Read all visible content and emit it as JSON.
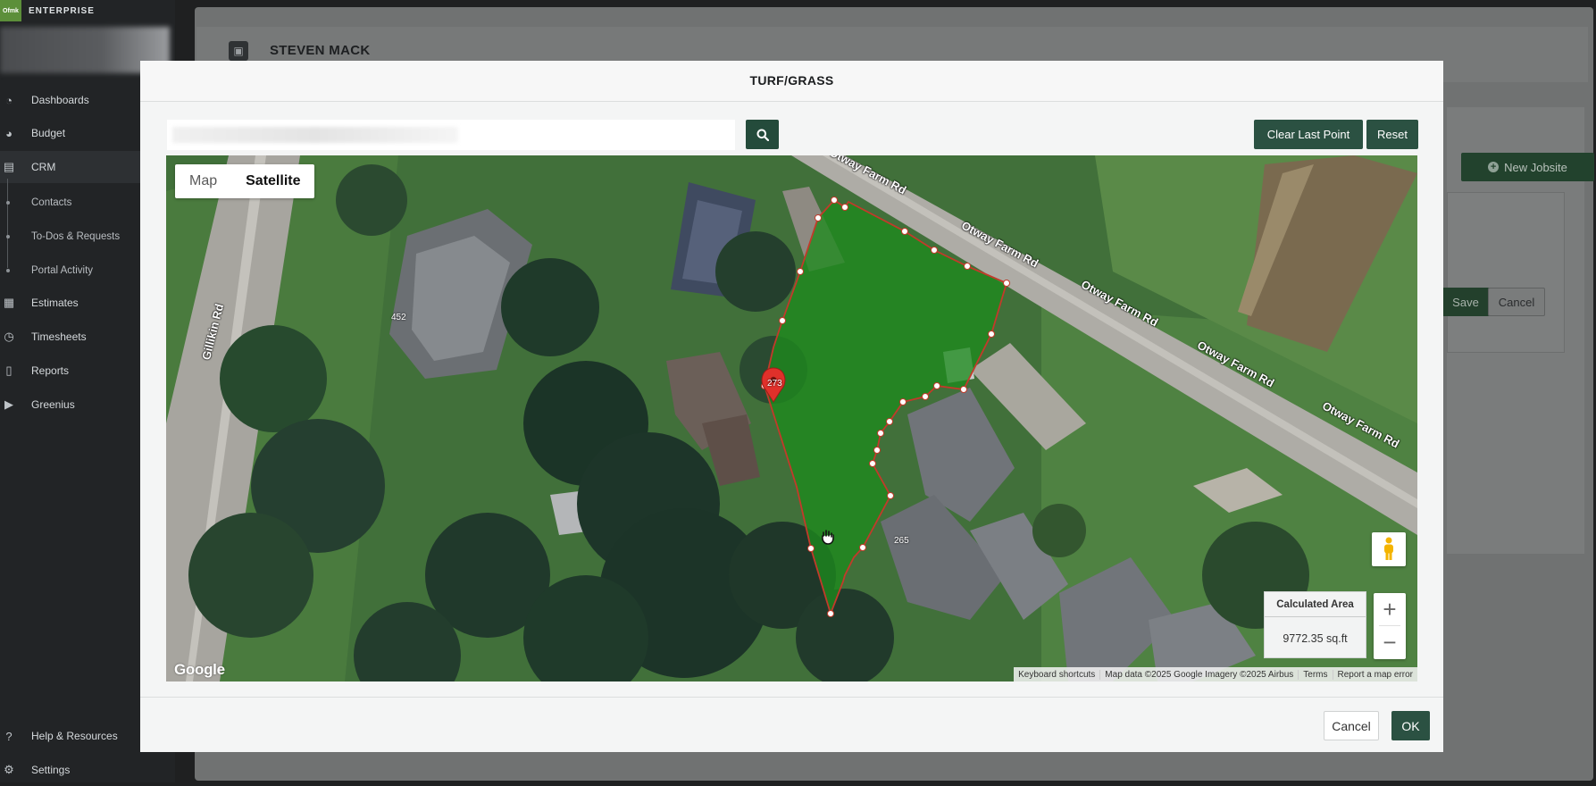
{
  "app": {
    "brand": "ENTERPRISE",
    "logo_text": "Ofmk"
  },
  "sidebar": {
    "items": [
      {
        "label": "Dashboards",
        "icon": "dashboard-icon"
      },
      {
        "label": "Budget",
        "icon": "pie-chart-icon"
      },
      {
        "label": "CRM",
        "icon": "contact-book-icon"
      },
      {
        "label": "Contacts"
      },
      {
        "label": "To-Dos & Requests"
      },
      {
        "label": "Portal Activity"
      },
      {
        "label": "Estimates",
        "icon": "calculator-icon"
      },
      {
        "label": "Timesheets",
        "icon": "clock-icon"
      },
      {
        "label": "Reports",
        "icon": "document-icon"
      },
      {
        "label": "Greenius",
        "icon": "play-circle-icon"
      }
    ],
    "bottom": [
      {
        "label": "Help & Resources",
        "icon": "help-icon"
      },
      {
        "label": "Settings",
        "icon": "gear-icon"
      }
    ]
  },
  "background_page": {
    "customer_name": "STEVEN MACK",
    "new_jobsite_label": "New Jobsite",
    "save_label": "Save",
    "cancel_label": "Cancel"
  },
  "dialog": {
    "title": "TURF/GRASS",
    "search": {
      "placeholder": "",
      "value": ""
    },
    "clear_last_point_label": "Clear Last Point",
    "reset_label": "Reset",
    "map": {
      "type_options": [
        "Map",
        "Satellite"
      ],
      "selected_type": "Satellite",
      "road_labels": [
        "Otway Farm Rd",
        "Otway Farm Rd",
        "Otway Farm Rd",
        "Otway Farm Rd",
        "Otway Farm Rd",
        "Gillikin Rd"
      ],
      "house_numbers": [
        "452",
        "273",
        "265"
      ],
      "calculated_area_label": "Calculated Area",
      "calculated_area_value": "9772.35 sq.ft",
      "zoom_in": "+",
      "zoom_out": "−",
      "google_logo": "Google",
      "attribution": [
        "Keyboard shortcuts",
        "Map data ©2025 Google Imagery ©2025 Airbus",
        "Terms",
        "Report a map error"
      ],
      "polygon_color": "#1e8a1e",
      "polygon_stroke": "#c23a2a"
    },
    "footer": {
      "cancel_label": "Cancel",
      "ok_label": "OK"
    }
  }
}
